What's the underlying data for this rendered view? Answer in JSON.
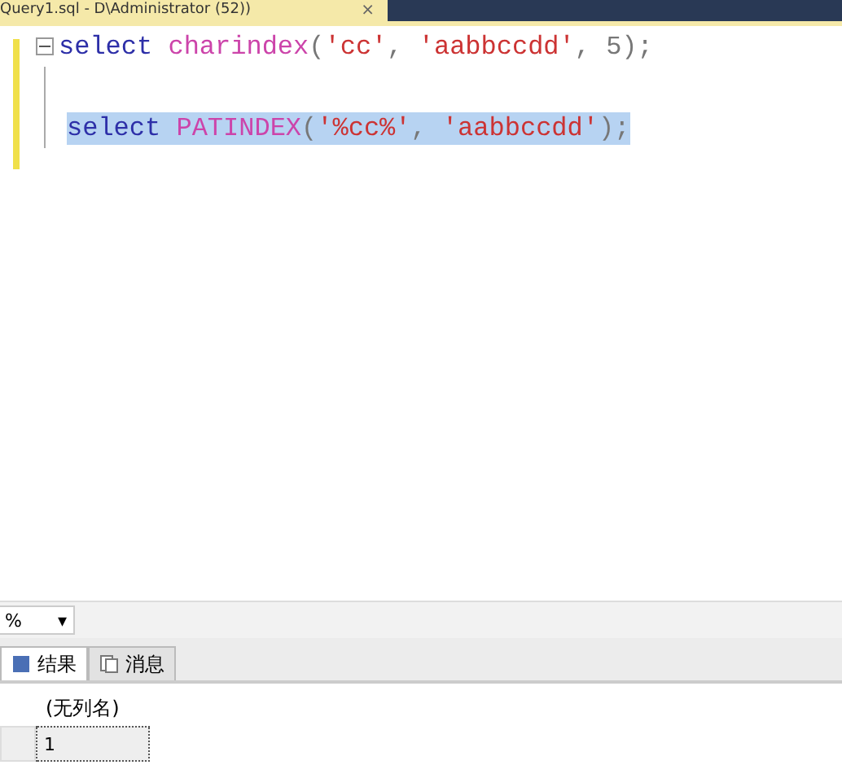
{
  "doc_tab": {
    "title": "Query1.sql - D\\Administrator (52))",
    "close": "×"
  },
  "editor": {
    "lines": [
      {
        "kind": "code",
        "selected": false,
        "tokens": [
          {
            "kind": "keyword",
            "text": "select "
          },
          {
            "kind": "function",
            "text": "charindex"
          },
          {
            "kind": "punct",
            "text": "("
          },
          {
            "kind": "string",
            "text": "'cc'"
          },
          {
            "kind": "punct",
            "text": ", "
          },
          {
            "kind": "string",
            "text": "'aabbccdd'"
          },
          {
            "kind": "punct",
            "text": ", 5);"
          }
        ]
      },
      {
        "kind": "blank"
      },
      {
        "kind": "code",
        "selected": true,
        "tokens": [
          {
            "kind": "keyword",
            "text": "select "
          },
          {
            "kind": "function",
            "text": "PATINDEX"
          },
          {
            "kind": "punct",
            "text": "("
          },
          {
            "kind": "string",
            "text": "'%cc%'"
          },
          {
            "kind": "punct",
            "text": ", "
          },
          {
            "kind": "string",
            "text": "'aabbccdd'"
          },
          {
            "kind": "punct",
            "text": ");"
          }
        ]
      }
    ]
  },
  "zoom": {
    "value": "%",
    "caret": "▾"
  },
  "result_tabs": [
    {
      "label": "结果",
      "selected": true
    },
    {
      "label": "消息",
      "selected": false
    }
  ],
  "grid": {
    "columns": [
      "(无列名)"
    ],
    "rows": [
      [
        "1"
      ]
    ]
  }
}
